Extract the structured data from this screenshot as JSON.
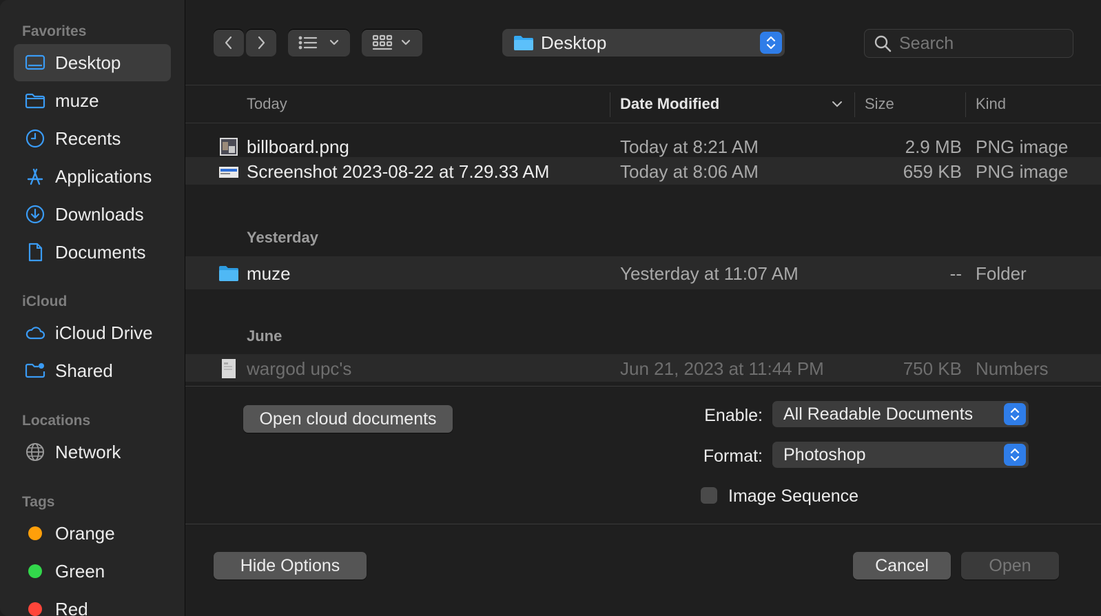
{
  "sidebar": {
    "favorites_heading": "Favorites",
    "favorites": [
      {
        "label": "Desktop",
        "icon": "desktop-icon",
        "selected": true
      },
      {
        "label": "muze",
        "icon": "folder-icon"
      },
      {
        "label": "Recents",
        "icon": "clock-icon"
      },
      {
        "label": "Applications",
        "icon": "applications-icon"
      },
      {
        "label": "Downloads",
        "icon": "download-icon"
      },
      {
        "label": "Documents",
        "icon": "document-icon"
      }
    ],
    "icloud_heading": "iCloud",
    "icloud": [
      {
        "label": "iCloud Drive",
        "icon": "cloud-icon"
      },
      {
        "label": "Shared",
        "icon": "shared-folder-icon"
      }
    ],
    "locations_heading": "Locations",
    "locations": [
      {
        "label": "Network",
        "icon": "globe-icon"
      }
    ],
    "tags_heading": "Tags",
    "tags": [
      {
        "label": "Orange",
        "color": "#ff9f0a"
      },
      {
        "label": "Green",
        "color": "#32d74b"
      },
      {
        "label": "Red",
        "color": "#ff453a"
      }
    ]
  },
  "toolbar": {
    "location": "Desktop",
    "search_placeholder": "Search"
  },
  "columns": {
    "name": "Today",
    "date": "Date Modified",
    "size": "Size",
    "kind": "Kind"
  },
  "groups": {
    "yesterday": "Yesterday",
    "june": "June"
  },
  "files": [
    {
      "name": "billboard.png",
      "date": "Today at 8:21 AM",
      "size": "2.9 MB",
      "kind": "PNG image"
    },
    {
      "name": "Screenshot 2023-08-22 at 7.29.33 AM",
      "date": "Today at 8:06 AM",
      "size": "659 KB",
      "kind": "PNG image"
    },
    {
      "name": "muze",
      "date": "Yesterday at 11:07 AM",
      "size": "--",
      "kind": "Folder"
    },
    {
      "name": "wargod upc's",
      "date": "Jun 21, 2023 at 11:44 PM",
      "size": "750 KB",
      "kind": "Numbers"
    }
  ],
  "options": {
    "open_cloud_label": "Open cloud documents",
    "enable_label": "Enable:",
    "enable_value": "All Readable Documents",
    "format_label": "Format:",
    "format_value": "Photoshop",
    "image_sequence_label": "Image Sequence",
    "image_sequence_checked": false
  },
  "footer": {
    "hide_options": "Hide Options",
    "cancel": "Cancel",
    "open": "Open"
  },
  "colors": {
    "accent": "#2f7de8",
    "sidebar_icon": "#3a9bf5",
    "folder": "#35a9f2"
  }
}
